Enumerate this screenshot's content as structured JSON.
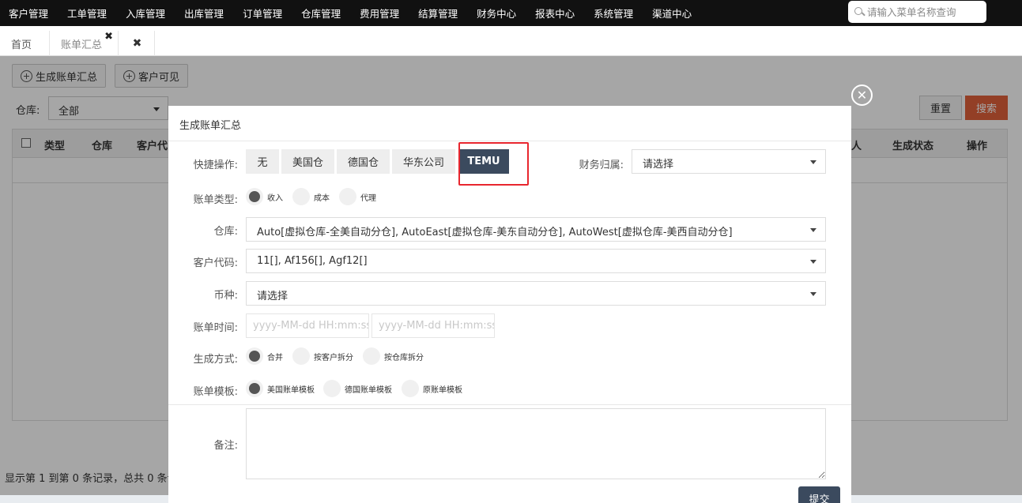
{
  "topnav": {
    "items": [
      "客户管理",
      "工单管理",
      "入库管理",
      "出库管理",
      "订单管理",
      "仓库管理",
      "费用管理",
      "结算管理",
      "财务中心",
      "报表中心",
      "系统管理",
      "渠道中心"
    ],
    "search_placeholder": "请输入菜单名称查询"
  },
  "tabs": {
    "home": "首页",
    "bill_summary": "账单汇总",
    "close_glyph": "✖",
    "close_all_glyph": "✖"
  },
  "page": {
    "generate_btn": "生成账单汇总",
    "customer_visible_btn": "客户可见",
    "warehouse_label": "仓库:",
    "warehouse_value": "全部",
    "reset_btn": "重置",
    "search_btn": "搜索",
    "table_headers": [
      "类型",
      "仓库",
      "客户代",
      "人",
      "生成状态",
      "操作"
    ],
    "footer": "显示第 1 到第 0 条记录，总共 0 条记"
  },
  "modal": {
    "title": "生成账单汇总",
    "close_glyph": "✕",
    "quick_label": "快捷操作:",
    "quick_options": [
      "无",
      "美国仓",
      "德国仓",
      "华东公司",
      "TEMU"
    ],
    "quick_selected": "TEMU",
    "finance_label": "财务归属:",
    "finance_value": "请选择",
    "bill_type_label": "账单类型:",
    "bill_types": [
      "收入",
      "成本",
      "代理"
    ],
    "bill_type_selected": "收入",
    "warehouse_label": "仓库:",
    "warehouse_value": "Auto[虚拟仓库-全美自动分仓], AutoEast[虚拟仓库-美东自动分仓], AutoWest[虚拟仓库-美西自动分仓]",
    "customer_label": "客户代码:",
    "customer_value": "11[], Af156[], Agf12[]",
    "currency_label": "币种:",
    "currency_value": "请选择",
    "time_label": "账单时间:",
    "time_start_placeholder": "yyyy-MM-dd HH:mm:ss",
    "time_end_placeholder": "yyyy-MM-dd HH:mm:ss",
    "gen_mode_label": "生成方式:",
    "gen_modes": [
      "合并",
      "按客户拆分",
      "按仓库拆分"
    ],
    "gen_mode_selected": "合并",
    "template_label": "账单模板:",
    "templates": [
      "美国账单模板",
      "德国账单模板",
      "原账单模板"
    ],
    "template_selected": "美国账单模板",
    "remark_label": "备注:",
    "remark_value": "",
    "submit_btn": "提交"
  },
  "colors": {
    "nav_bg": "#111111",
    "primary_dark": "#3b4a5e",
    "search_orange": "#e2623b",
    "highlight_red": "#e8262e"
  }
}
